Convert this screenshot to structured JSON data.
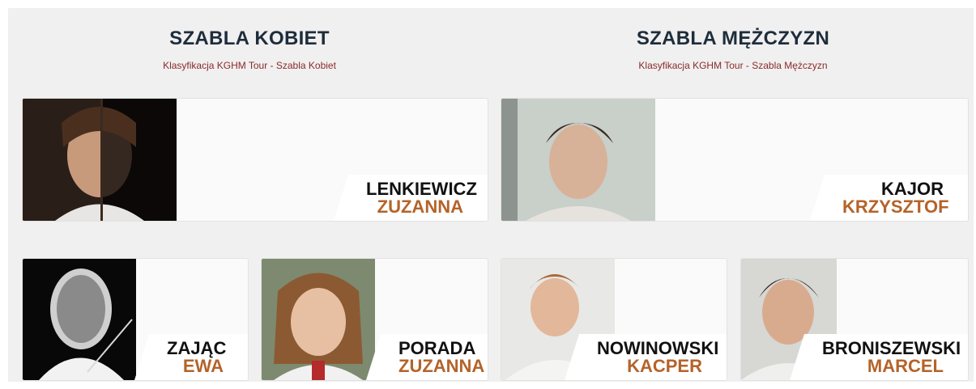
{
  "women": {
    "title": "SZABLA KOBIET",
    "subtitle": "Klasyfikacja KGHM Tour - Szabla Kobiet",
    "leader": {
      "surname": "LENKIEWICZ",
      "firstname": "ZUZANNA",
      "photo": "fencer-portrait-half-shadow"
    },
    "others": [
      {
        "surname": "ZAJĄC",
        "firstname": "EWA",
        "photo": "fencing-mask"
      },
      {
        "surname": "PORADA",
        "firstname": "ZUZANNA",
        "photo": "fencer-portrait-smiling"
      }
    ]
  },
  "men": {
    "title": "SZABLA MĘŻCZYZN",
    "subtitle": "Klasyfikacja KGHM Tour - Szabla Mężczyzn",
    "leader": {
      "surname": "KAJOR",
      "firstname": "KRZYSZTOF",
      "photo": "fencer-portrait"
    },
    "others": [
      {
        "surname": "NOWINOWSKI",
        "firstname": "KACPER",
        "photo": "fencer-portrait"
      },
      {
        "surname": "BRONISZEWSKI",
        "firstname": "MARCEL",
        "photo": "fencer-portrait"
      }
    ]
  },
  "colors": {
    "title": "#1e2d3b",
    "subtitle": "#8a2a2a",
    "firstname": "#b4632a",
    "surname": "#111111",
    "panel": "#f0f0f0"
  }
}
